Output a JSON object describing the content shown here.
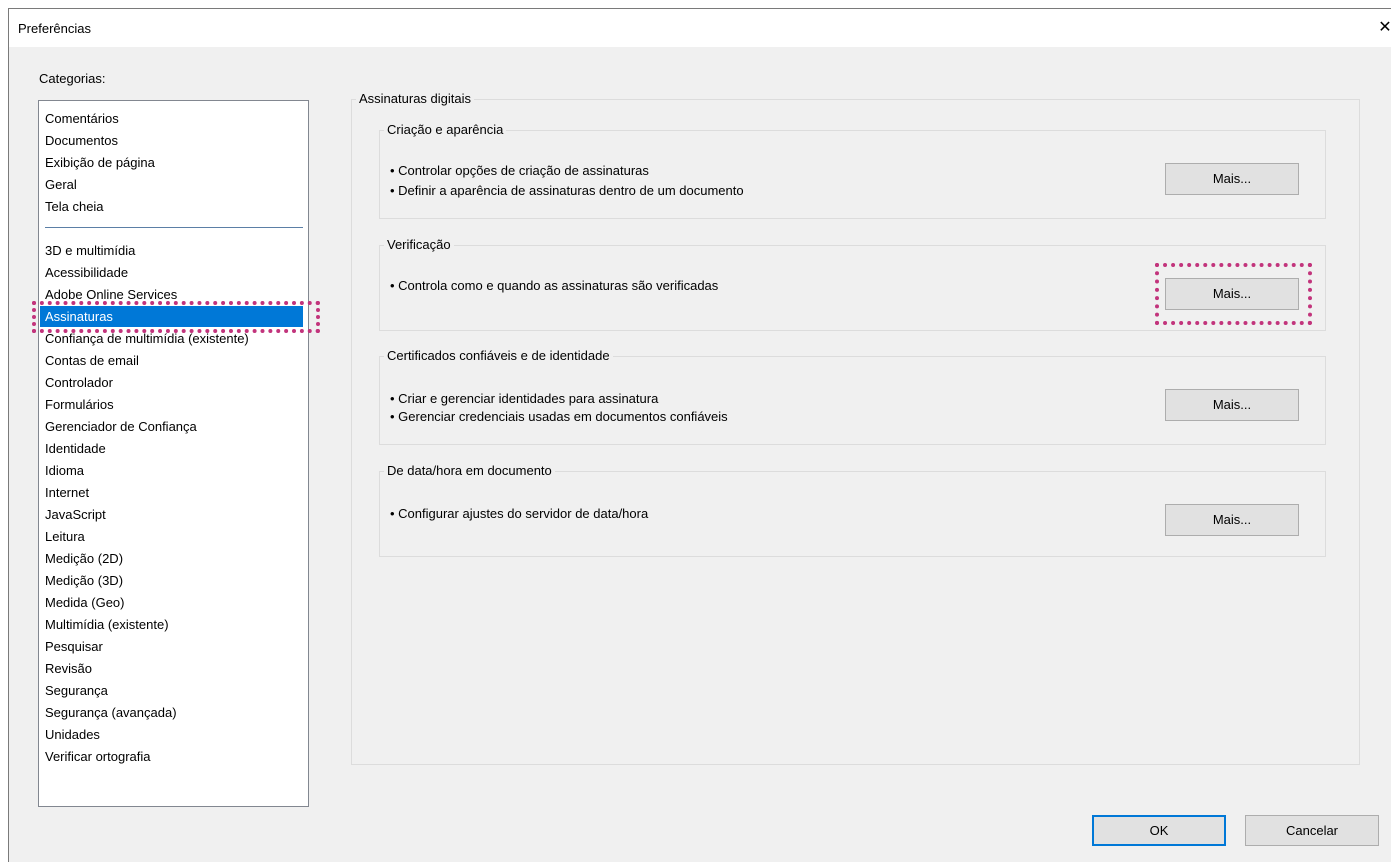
{
  "window": {
    "title": "Preferências",
    "close_glyph": "✕"
  },
  "categories": {
    "label": "Categorias:",
    "top_items": [
      "Comentários",
      "Documentos",
      "Exibição de página",
      "Geral",
      "Tela cheia"
    ],
    "items": [
      "3D e multimídia",
      "Acessibilidade",
      "Adobe Online Services",
      "Assinaturas",
      "Confiança de multimídia (existente)",
      "Contas de email",
      "Controlador",
      "Formulários",
      "Gerenciador de Confiança",
      "Identidade",
      "Idioma",
      "Internet",
      "JavaScript",
      "Leitura",
      "Medição (2D)",
      "Medição (3D)",
      "Medida (Geo)",
      "Multimídia (existente)",
      "Pesquisar",
      "Revisão",
      "Segurança",
      "Segurança (avançada)",
      "Unidades",
      "Verificar ortografia"
    ],
    "selected": "Assinaturas"
  },
  "main": {
    "title": "Assinaturas digitais",
    "groups": [
      {
        "title": "Criação e aparência",
        "lines": [
          "• Controlar opções de criação de assinaturas",
          "• Definir a aparência de assinaturas dentro de um documento"
        ],
        "button": "Mais..."
      },
      {
        "title": "Verificação",
        "lines": [
          "• Controla como e quando as assinaturas são verificadas"
        ],
        "button": "Mais..."
      },
      {
        "title": "Certificados confiáveis e de identidade",
        "lines": [
          "• Criar e gerenciar identidades para assinatura",
          "• Gerenciar credenciais usadas em documentos confiáveis"
        ],
        "button": "Mais..."
      },
      {
        "title": "De data/hora em documento",
        "lines": [
          "• Configurar ajustes do servidor de data/hora"
        ],
        "button": "Mais..."
      }
    ]
  },
  "footer": {
    "ok_label": "OK",
    "cancel_label": "Cancelar"
  },
  "colors": {
    "selection": "#0078d7",
    "highlight": "#c2347c",
    "window_bg": "#f0f0f0"
  }
}
